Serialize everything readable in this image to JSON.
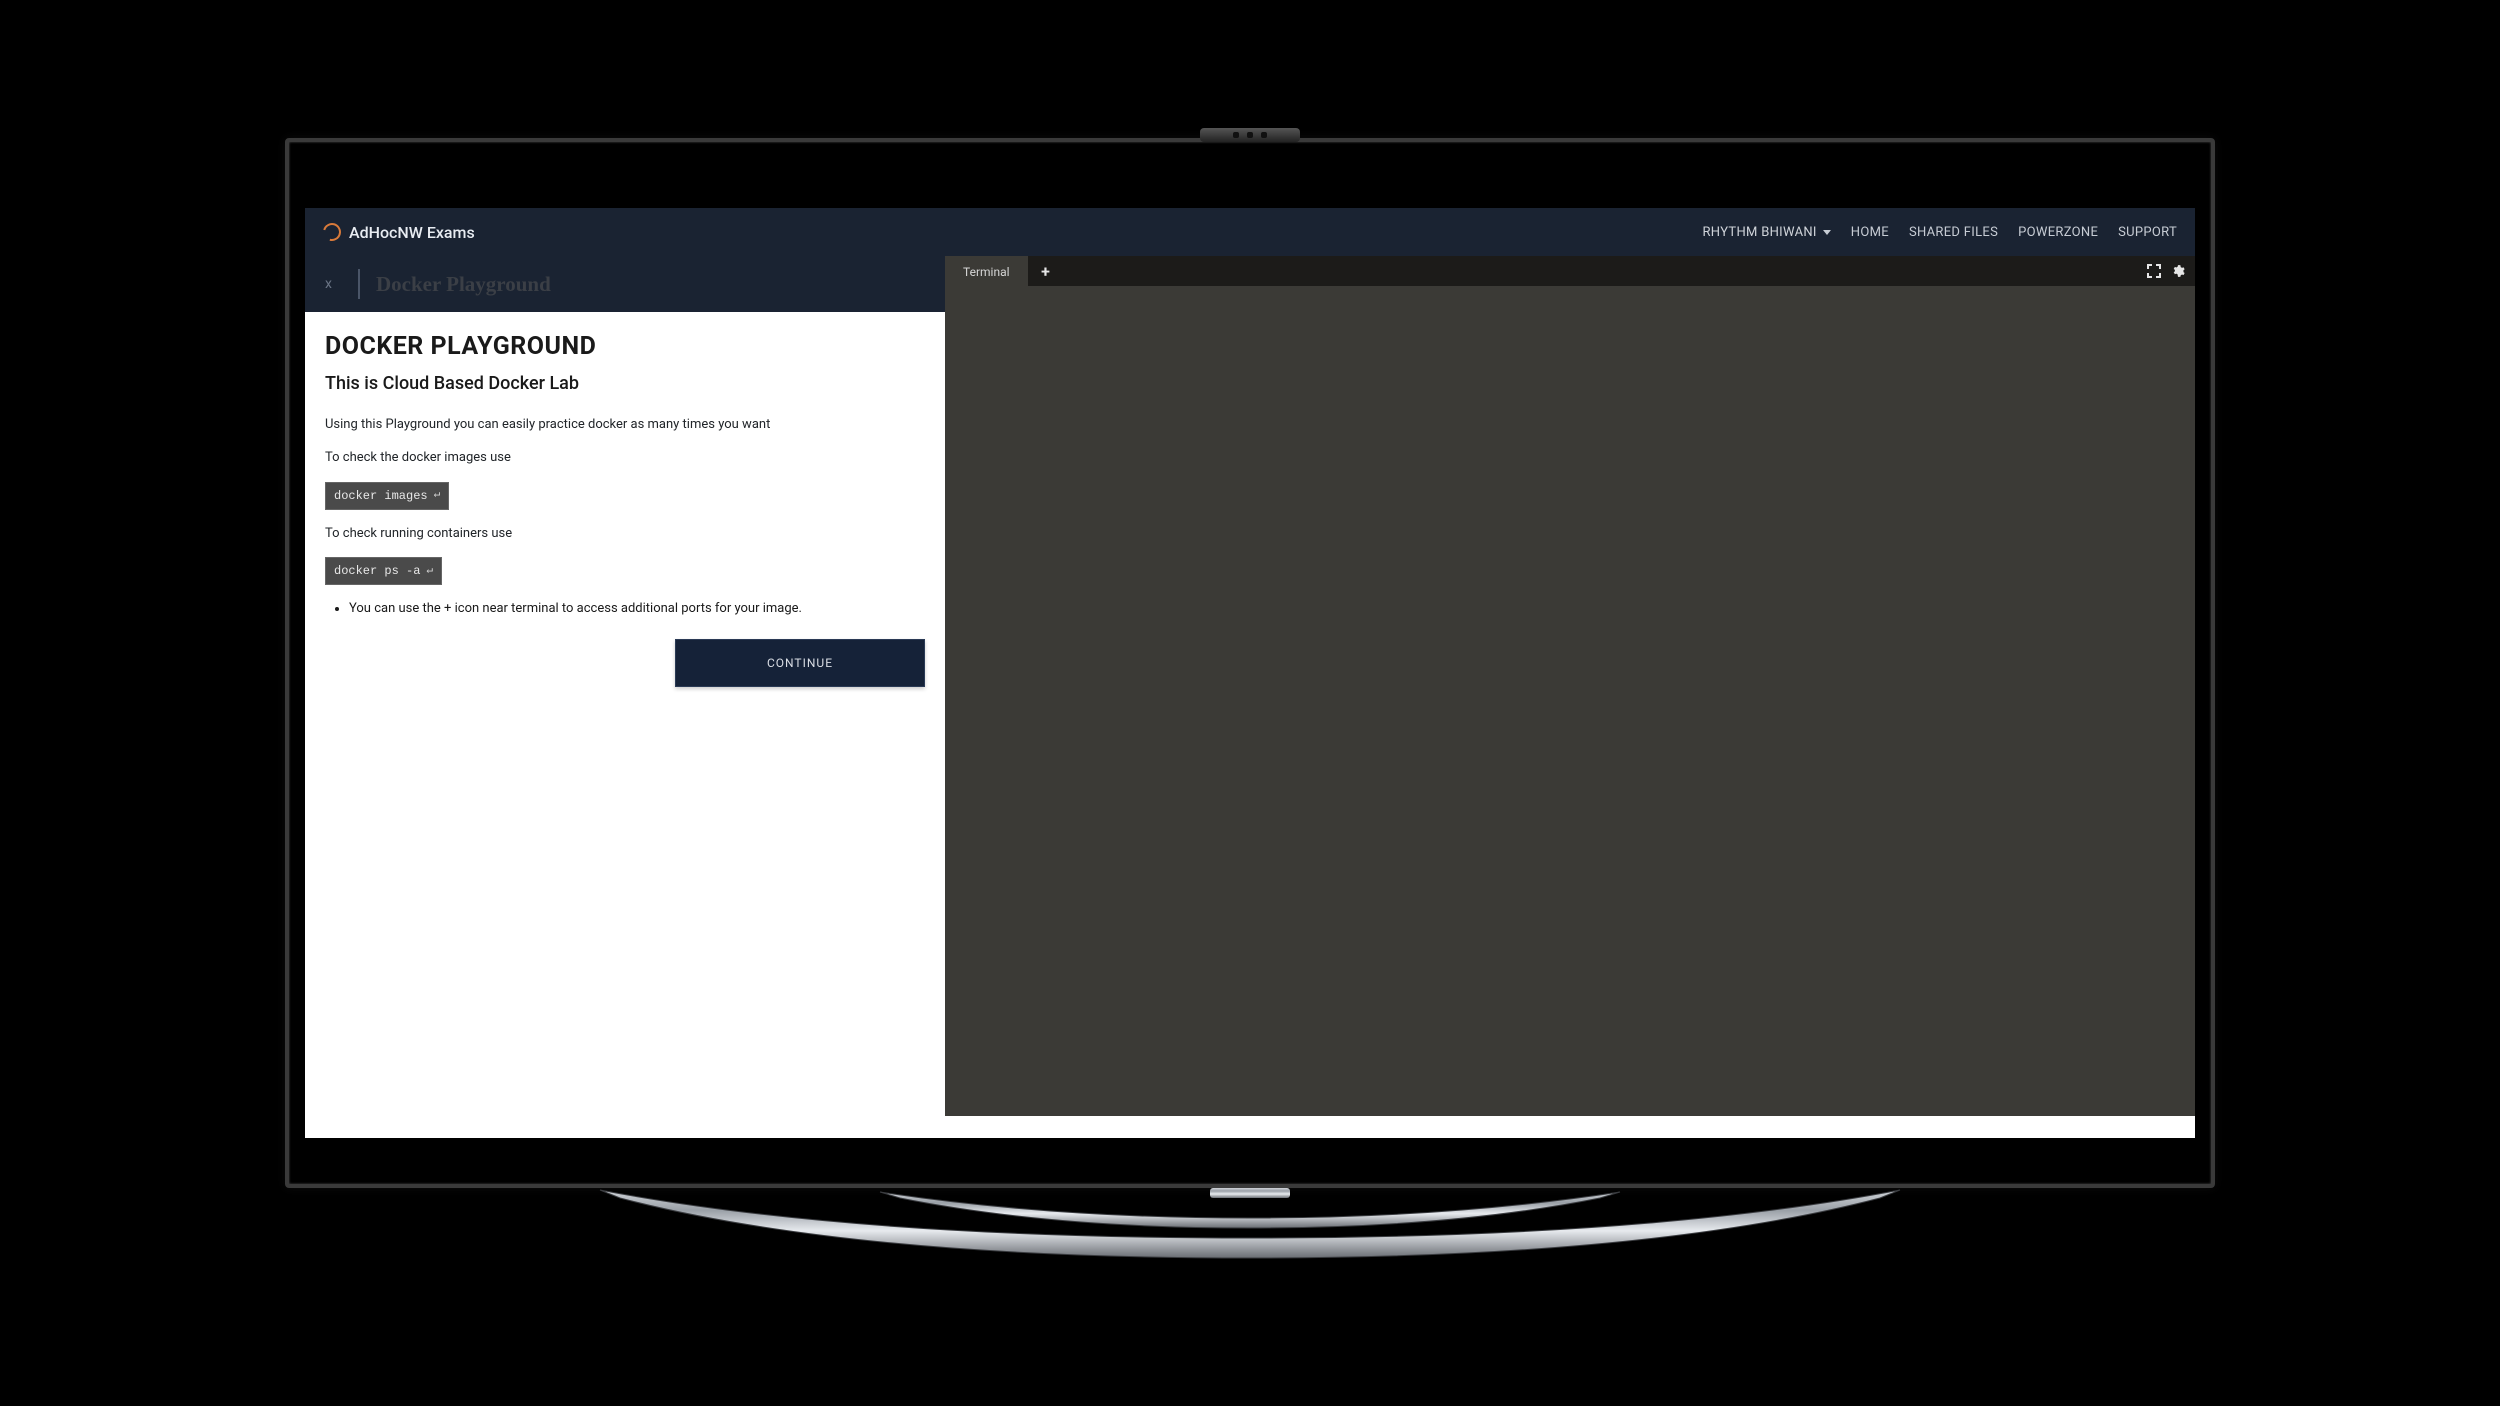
{
  "nav": {
    "brand": "AdHocNW Exams",
    "user": "RHYTHM BHIWANI",
    "links": [
      "HOME",
      "SHARED FILES",
      "POWERZONE",
      "SUPPORT"
    ]
  },
  "tab": {
    "close": "x",
    "title": "Docker Playground"
  },
  "doc": {
    "heading": "DOCKER PLAYGROUND",
    "subheading": "This is Cloud Based Docker Lab",
    "intro": "Using this Playground you can easily practice docker as many times you want",
    "p_images": "To check the docker images use",
    "cmd_images": "docker images",
    "p_ps": "To check running containers use",
    "cmd_ps": "docker ps -a",
    "bullet": "You can use the + icon near terminal to access additional ports for your image.",
    "continue": "CONTINUE"
  },
  "terminal": {
    "tab_label": "Terminal"
  }
}
